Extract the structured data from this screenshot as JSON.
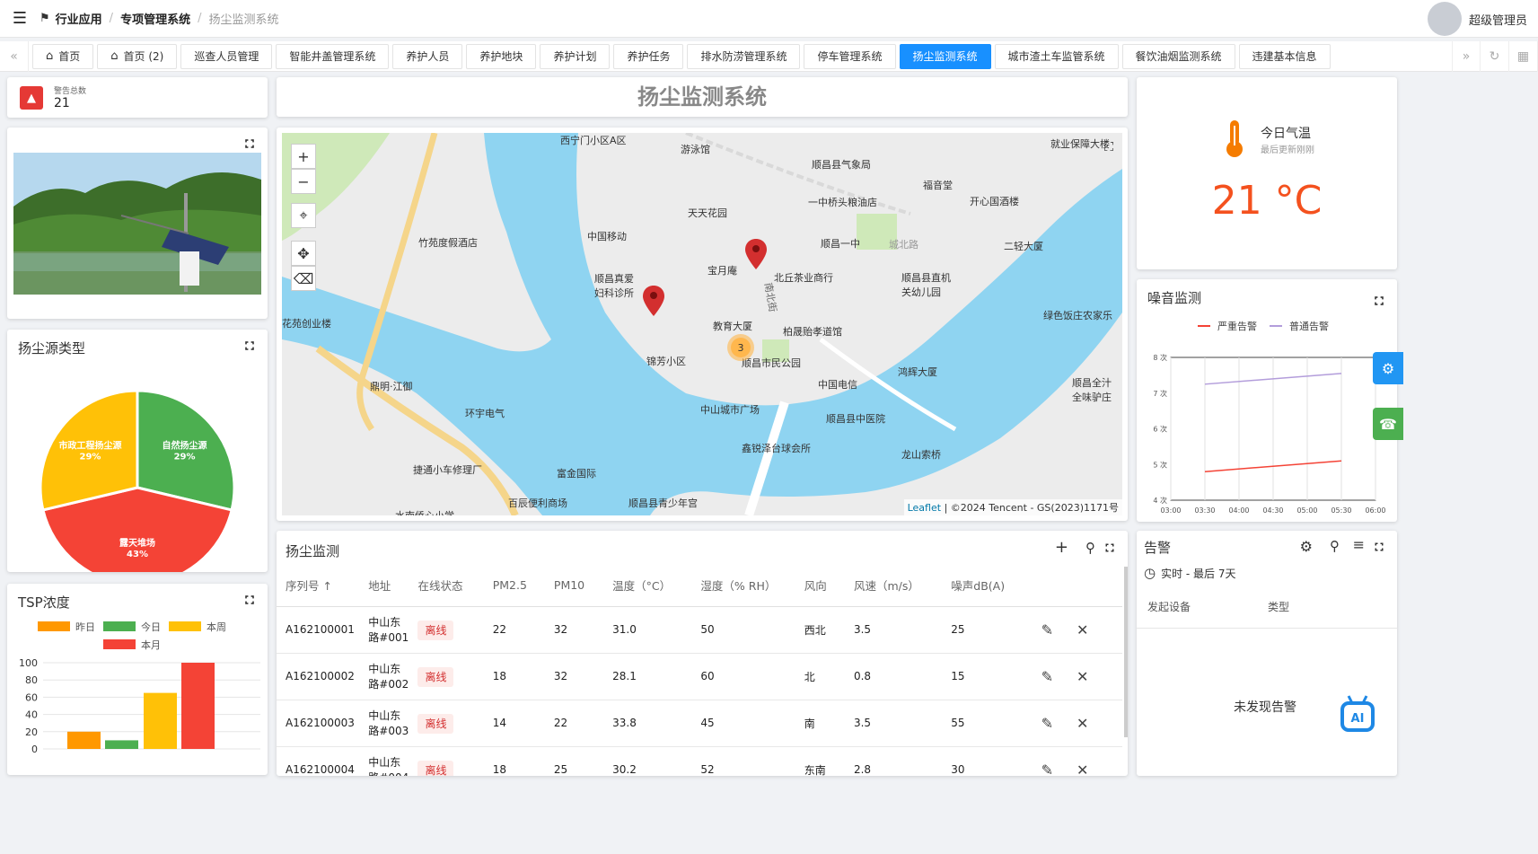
{
  "header": {
    "breadcrumb": [
      "行业应用",
      "专项管理系统",
      "扬尘监测系统"
    ],
    "user_name": "超级管理员"
  },
  "tabs": [
    {
      "label": "首页",
      "home": true,
      "active": false
    },
    {
      "label": "首页 (2)",
      "home": true,
      "active": false
    },
    {
      "label": "巡查人员管理",
      "active": false
    },
    {
      "label": "智能井盖管理系统",
      "active": false
    },
    {
      "label": "养护人员",
      "active": false
    },
    {
      "label": "养护地块",
      "active": false
    },
    {
      "label": "养护计划",
      "active": false
    },
    {
      "label": "养护任务",
      "active": false
    },
    {
      "label": "排水防涝管理系统",
      "active": false
    },
    {
      "label": "停车管理系统",
      "active": false
    },
    {
      "label": "扬尘监测系统",
      "active": true
    },
    {
      "label": "城市渣土车监管系统",
      "active": false
    },
    {
      "label": "餐饮油烟监测系统",
      "active": false
    },
    {
      "label": "违建基本信息",
      "active": false
    }
  ],
  "alarm_total": {
    "label": "警告总数",
    "value": "21"
  },
  "map": {
    "title": "扬尘监测系统",
    "cluster_count": "3",
    "attribution_leaflet": "Leaflet",
    "attribution": "| ©2024 Tencent - GS(2023)1171号",
    "pois": [
      "西宁门小区A区",
      "游泳馆",
      "顺昌县气象局",
      "就业保障大楼",
      "福音堂",
      "一中桥头粮油店",
      "天天花园",
      "开心国酒楼",
      "中国移动",
      "竹苑度假酒店",
      "顺昌一中",
      "城北路",
      "二轻大厦",
      "宝月庵",
      "北丘茶业商行",
      "顺昌真爱妇科诊所",
      "顺昌县直机关幼儿园",
      "花苑创业楼",
      "教育大厦",
      "柏晟贻孝道馆",
      "绿色饭庄农家乐",
      "锦芳小区",
      "顺昌市民公园",
      "鼎明·江御",
      "中国电信",
      "鸿辉大厦",
      "顺昌全汁全味驴庄",
      "环宇电气",
      "中山城市广场",
      "顺昌县中医院",
      "鑫锐泽台球会所",
      "龙山索桥",
      "捷通小车修理厂",
      "富金国际",
      "百辰便利商场",
      "顺昌县青少年宫",
      "水南侨心小学",
      "南北街"
    ]
  },
  "temperature": {
    "title": "今日气温",
    "subtitle": "最后更新刚刚",
    "value": "21 °C"
  },
  "dust_types": {
    "title": "扬尘源类型",
    "chart_data": {
      "type": "pie",
      "slices": [
        {
          "name": "自然扬尘源",
          "value": 29,
          "label": "29%",
          "color": "#4caf50"
        },
        {
          "name": "露天堆场",
          "value": 43,
          "label": "43%",
          "color": "#f44336"
        },
        {
          "name": "市政工程扬尘源",
          "value": 29,
          "label": "29%",
          "color": "#ffc107"
        }
      ]
    }
  },
  "tsp": {
    "title": "TSP浓度",
    "chart_data": {
      "type": "bar",
      "series": [
        {
          "name": "昨日",
          "value": 20,
          "color": "#ff9800"
        },
        {
          "name": "今日",
          "value": 10,
          "color": "#4caf50"
        },
        {
          "name": "本周",
          "value": 65,
          "color": "#ffc107"
        },
        {
          "name": "本月",
          "value": 100,
          "color": "#f44336"
        }
      ],
      "yticks": [
        "100",
        "80",
        "60",
        "40",
        "20",
        "0"
      ],
      "ylim": [
        0,
        100
      ]
    }
  },
  "noise": {
    "title": "噪音监测",
    "chart_data": {
      "type": "line",
      "x": [
        "03:00",
        "03:30",
        "04:00",
        "04:30",
        "05:00",
        "05:30",
        "06:00"
      ],
      "yticks": [
        "8 次",
        "7 次",
        "6 次",
        "5 次",
        "4 次"
      ],
      "ylim": [
        4,
        8
      ],
      "series": [
        {
          "name": "严重告警",
          "color": "#f44336",
          "points": [
            [
              "03:30",
              4.8
            ],
            [
              "05:30",
              5.1
            ]
          ]
        },
        {
          "name": "普通告警",
          "color": "#b39ddb",
          "points": [
            [
              "03:30",
              7.25
            ],
            [
              "05:30",
              7.55
            ]
          ]
        }
      ]
    }
  },
  "dust_table": {
    "title": "扬尘监测",
    "columns": [
      "序列号 ↑",
      "地址",
      "在线状态",
      "PM2.5",
      "PM10",
      "温度（°C）",
      "湿度（% RH）",
      "风向",
      "风速（m/s）",
      "噪声dB(A)"
    ],
    "rows": [
      {
        "id": "A162100001",
        "addr1": "中山东",
        "addr2": "路#001",
        "status": "离线",
        "pm25": "22",
        "pm10": "32",
        "temp": "31.0",
        "hum": "50",
        "dir": "西北",
        "speed": "3.5",
        "noise": "25"
      },
      {
        "id": "A162100002",
        "addr1": "中山东",
        "addr2": "路#002",
        "status": "离线",
        "pm25": "18",
        "pm10": "32",
        "temp": "28.1",
        "hum": "60",
        "dir": "北",
        "speed": "0.8",
        "noise": "15"
      },
      {
        "id": "A162100003",
        "addr1": "中山东",
        "addr2": "路#003",
        "status": "离线",
        "pm25": "14",
        "pm10": "22",
        "temp": "33.8",
        "hum": "45",
        "dir": "南",
        "speed": "3.5",
        "noise": "55"
      },
      {
        "id": "A162100004",
        "addr1": "中山东",
        "addr2": "路#004",
        "status": "离线",
        "pm25": "18",
        "pm10": "25",
        "temp": "30.2",
        "hum": "52",
        "dir": "东南",
        "speed": "2.8",
        "noise": "30"
      }
    ]
  },
  "alerts": {
    "title": "告警",
    "filter": "实时 - 最后 7天",
    "col_device": "发起设备",
    "col_type": "类型",
    "empty": "未发现告警"
  }
}
